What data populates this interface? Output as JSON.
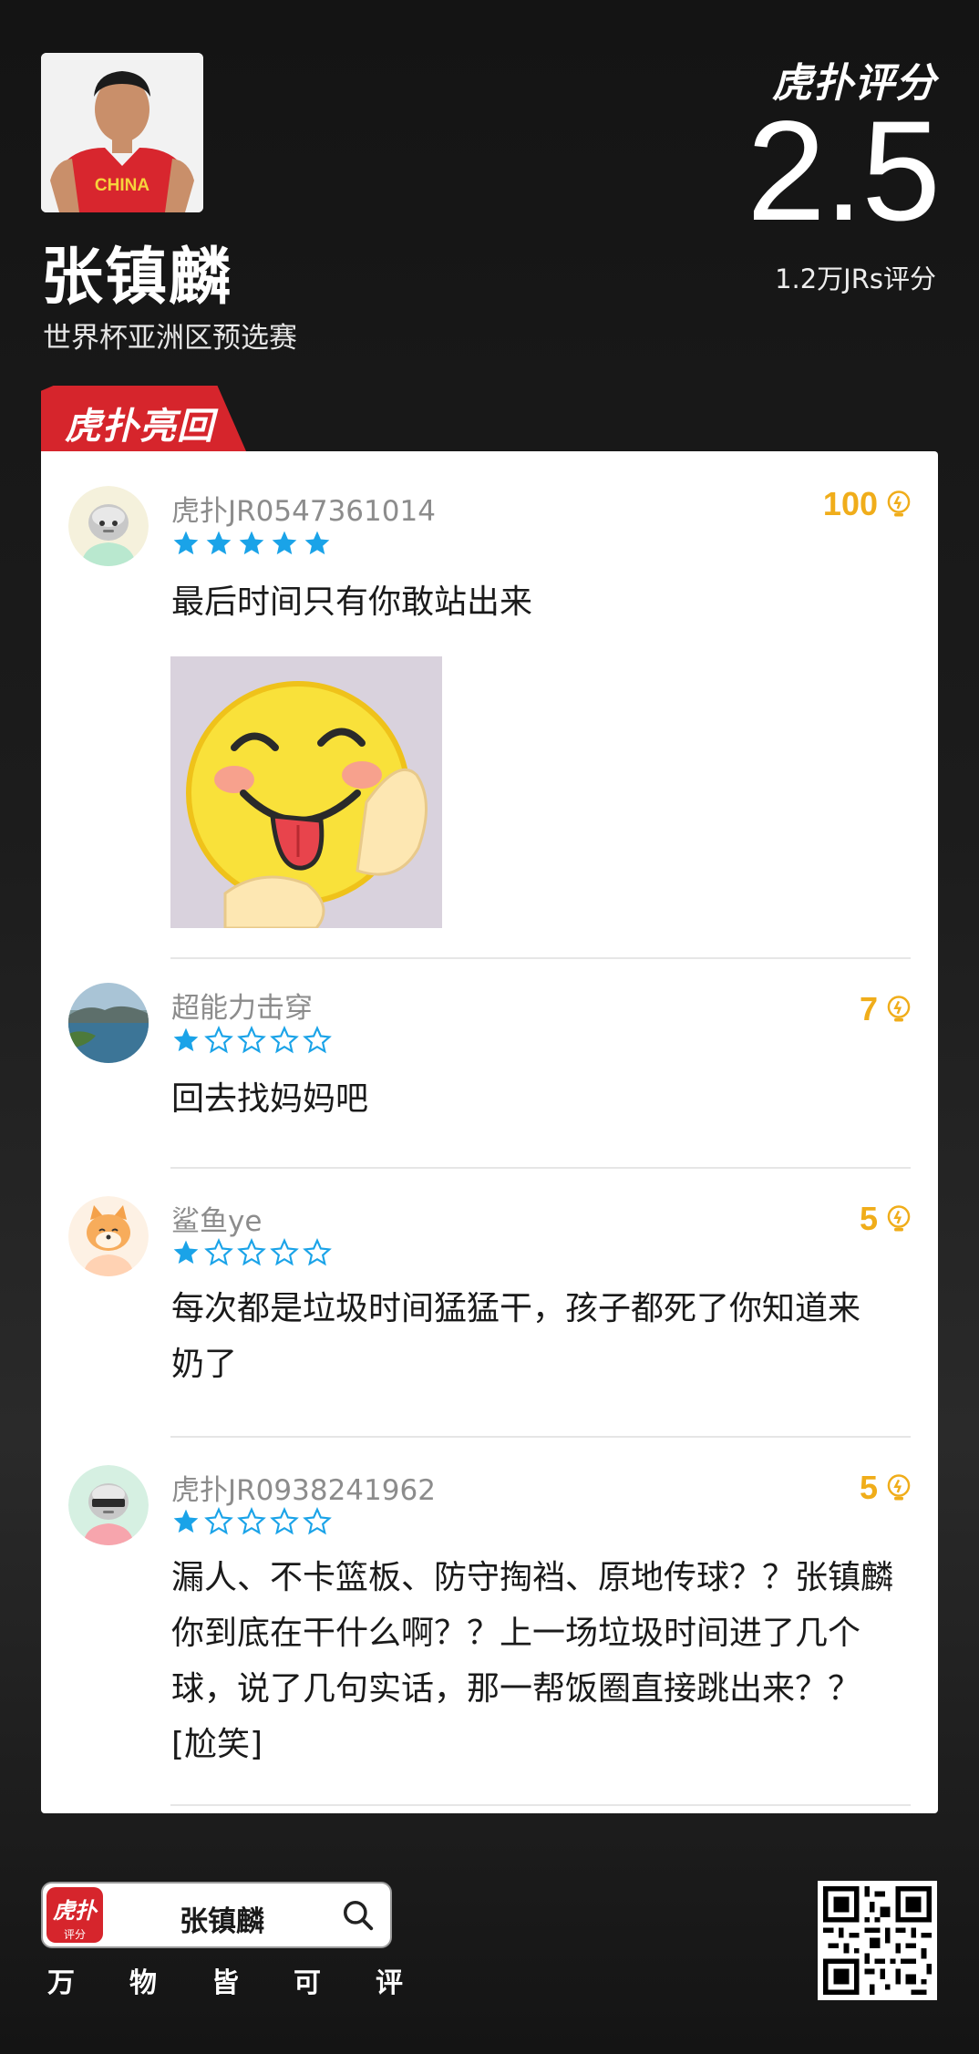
{
  "player": {
    "name": "张镇麟",
    "event": "世界杯亚洲区预选赛",
    "jersey_text": "CHINA"
  },
  "brand": {
    "logo_text": "虎扑评分",
    "score": "2.5",
    "ratings_count": "1.2万JRs评分"
  },
  "tag": {
    "label": "虎扑亮回复"
  },
  "comments": [
    {
      "user": "虎扑JR0547361014",
      "stars": 5,
      "likes": "100",
      "text": "最后时间只有你敢站出来",
      "has_image": true
    },
    {
      "user": "超能力击穿",
      "stars": 1,
      "likes": "7",
      "text": "回去找妈妈吧"
    },
    {
      "user": "鲨鱼ye",
      "stars": 1,
      "likes": "5",
      "text": "每次都是垃圾时间猛猛干，孩子都死了你知道来奶了"
    },
    {
      "user": "虎扑JR0938241962",
      "stars": 1,
      "likes": "5",
      "text": "漏人、不卡篮板、防守掏裆、原地传球？？张镇麟你到底在干什么啊？？上一场垃圾时间进了几个球，说了几句实话，那一帮饭圈直接跳出来？？[尬笑]"
    }
  ],
  "footer": {
    "app_icon_big": "虎扑",
    "app_icon_small": "评分",
    "search_text": "张镇麟",
    "slogan": [
      "万",
      "物",
      "皆",
      "可",
      "评"
    ]
  },
  "colors": {
    "accent_red": "#d6252c",
    "star_blue": "#1aa3e8",
    "likes_gold": "#f0ad1a"
  }
}
